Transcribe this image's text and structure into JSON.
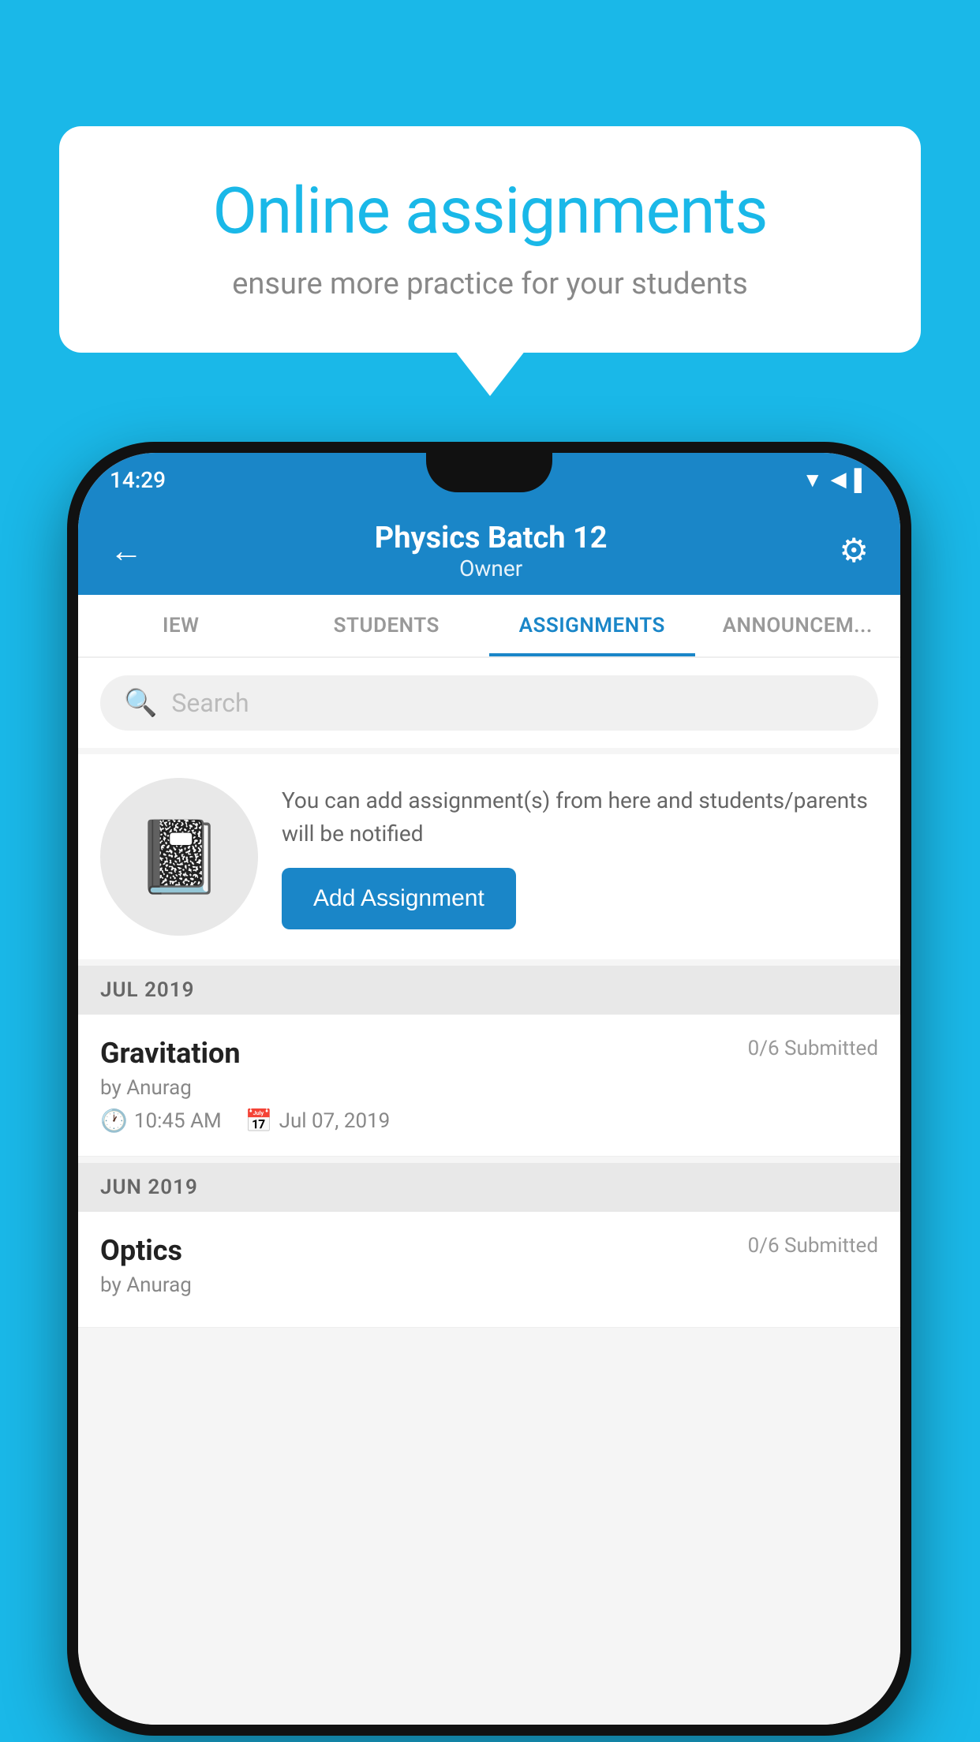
{
  "background_color": "#1ab8e8",
  "speech_bubble": {
    "title": "Online assignments",
    "subtitle": "ensure more practice for your students"
  },
  "phone": {
    "status_bar": {
      "time": "14:29",
      "icons": [
        "wifi",
        "signal",
        "battery"
      ]
    },
    "header": {
      "title": "Physics Batch 12",
      "subtitle": "Owner",
      "back_label": "←",
      "settings_label": "⚙"
    },
    "tabs": [
      {
        "label": "IEW",
        "active": false
      },
      {
        "label": "STUDENTS",
        "active": false
      },
      {
        "label": "ASSIGNMENTS",
        "active": true
      },
      {
        "label": "ANNOUNCEM...",
        "active": false
      }
    ],
    "search": {
      "placeholder": "Search"
    },
    "promo": {
      "icon": "📓",
      "text": "You can add assignment(s) from here and students/parents will be notified",
      "button_label": "Add Assignment"
    },
    "sections": [
      {
        "label": "JUL 2019",
        "assignments": [
          {
            "name": "Gravitation",
            "submitted": "0/6 Submitted",
            "by": "by Anurag",
            "time": "10:45 AM",
            "date": "Jul 07, 2019"
          }
        ]
      },
      {
        "label": "JUN 2019",
        "assignments": [
          {
            "name": "Optics",
            "submitted": "0/6 Submitted",
            "by": "by Anurag",
            "time": "",
            "date": ""
          }
        ]
      }
    ]
  }
}
